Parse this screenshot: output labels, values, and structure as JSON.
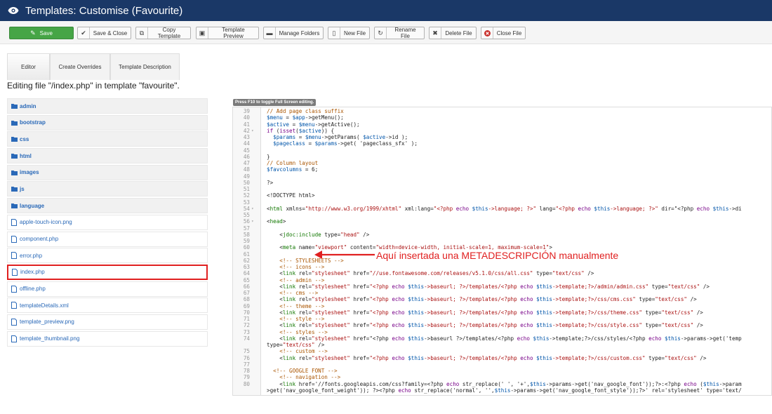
{
  "header": {
    "title": "Templates: Customise (Favourite)",
    "icon": "eye-icon"
  },
  "toolbar": {
    "save": "Save",
    "save_close": "Save & Close",
    "copy_template": "Copy Template",
    "template_preview": "Template Preview",
    "manage_folders": "Manage Folders",
    "new_file": "New File",
    "rename_file": "Rename File",
    "delete_file": "Delete File",
    "close_file": "Close File"
  },
  "tabs": [
    "Editor",
    "Create Overrides",
    "Template Description"
  ],
  "editing_text": "Editing file \"/index.php\" in template \"favourite\".",
  "tree": {
    "folders": [
      "admin",
      "bootstrap",
      "css",
      "html",
      "images",
      "js",
      "language"
    ],
    "files": [
      "apple-touch-icon.png",
      "component.php",
      "error.php",
      "index.php",
      "offline.php",
      "templateDetails.xml",
      "template_preview.png",
      "template_thumbnail.png"
    ],
    "selected": "index.php"
  },
  "editor": {
    "hint": "Press F10 to toggle Full Screen editing.",
    "lines": [
      [
        "39",
        "",
        "// Add page class suffix"
      ],
      [
        "40",
        "",
        "$menu = $app->getMenu();"
      ],
      [
        "41",
        "",
        "$active = $menu->getActive();"
      ],
      [
        "42",
        "▾",
        "if (isset($active)) {"
      ],
      [
        "43",
        "",
        "  $params = $menu->getParams( $active->id );"
      ],
      [
        "44",
        "",
        "  $pageclass = $params->get( 'pageclass_sfx' );"
      ],
      [
        "45",
        "",
        ""
      ],
      [
        "46",
        "",
        "}"
      ],
      [
        "47",
        "",
        "// Column layout"
      ],
      [
        "48",
        "",
        "$favcolumns = 6;"
      ],
      [
        "49",
        "",
        ""
      ],
      [
        "50",
        "",
        "?>"
      ],
      [
        "51",
        "",
        ""
      ],
      [
        "52",
        "",
        "<!DOCTYPE html>"
      ],
      [
        "53",
        "",
        ""
      ],
      [
        "54",
        "▾",
        "<html xmlns=\"http://www.w3.org/1999/xhtml\" xml:lang=\"<?php echo $this->language; ?>\" lang=\"<?php echo $this->language; ?>\" dir=\"<?php echo $this->di"
      ],
      [
        "55",
        "",
        ""
      ],
      [
        "56",
        "▾",
        "<head>"
      ],
      [
        "57",
        "",
        ""
      ],
      [
        "58",
        "",
        "    <jdoc:include type=\"head\" />"
      ],
      [
        "59",
        "",
        ""
      ],
      [
        "60",
        "",
        "    <meta name=\"viewport\" content=\"width=device-width, initial-scale=1, maximum-scale=1\">"
      ],
      [
        "61",
        "",
        ""
      ],
      [
        "62",
        "",
        "    <!-- STYLESHEETS -->"
      ],
      [
        "63",
        "",
        "    <!-- icons -->"
      ],
      [
        "64",
        "",
        "    <link rel=\"stylesheet\" href=\"//use.fontawesome.com/releases/v5.1.0/css/all.css\" type=\"text/css\" />"
      ],
      [
        "65",
        "",
        "    <!-- admin -->"
      ],
      [
        "66",
        "",
        "    <link rel=\"stylesheet\" href=\"<?php echo $this->baseurl; ?>/templates/<?php echo $this->template;?>/admin/admin.css\" type=\"text/css\" />"
      ],
      [
        "67",
        "",
        "    <!-- cms -->"
      ],
      [
        "68",
        "",
        "    <link rel=\"stylesheet\" href=\"<?php echo $this->baseurl; ?>/templates/<?php echo $this->template;?>/css/cms.css\" type=\"text/css\" />"
      ],
      [
        "69",
        "",
        "    <!-- theme -->"
      ],
      [
        "70",
        "",
        "    <link rel=\"stylesheet\" href=\"<?php echo $this->baseurl; ?>/templates/<?php echo $this->template;?>/css/theme.css\" type=\"text/css\" />"
      ],
      [
        "71",
        "",
        "    <!-- style -->"
      ],
      [
        "72",
        "",
        "    <link rel=\"stylesheet\" href=\"<?php echo $this->baseurl; ?>/templates/<?php echo $this->template;?>/css/style.css\" type=\"text/css\" />"
      ],
      [
        "73",
        "",
        "    <!-- styles -->"
      ],
      [
        "74",
        "",
        "    <link rel=\"stylesheet\" href=\"<?php echo $this->baseurl ?>/templates/<?php echo $this->template;?>/css/styles/<?php echo $this->params->get('temp"
      ],
      [
        "",
        "",
        "type=\"text/css\" />"
      ],
      [
        "75",
        "",
        "    <!-- custom -->"
      ],
      [
        "76",
        "",
        "    <link rel=\"stylesheet\" href=\"<?php echo $this->baseurl; ?>/templates/<?php echo $this->template;?>/css/custom.css\" type=\"text/css\" />"
      ],
      [
        "77",
        "",
        ""
      ],
      [
        "78",
        "",
        "  <!-- GOOGLE FONT -->"
      ],
      [
        "79",
        "",
        "    <!-- navigation -->"
      ],
      [
        "80",
        "",
        "    <link href='//fonts.googleapis.com/css?family=<?php echo str_replace(' ', '+',$this->params->get('nav_google_font'));?>:<?php echo ($this->param"
      ],
      [
        "",
        "",
        ">get('nav_google_font_weight')); ?><?php echo str_replace('normal', '',$this->params->get('nav_google_font_style'));?>' rel='stylesheet' type='text/"
      ]
    ]
  },
  "annotation": "Aquí insertada una METADESCRIPCIÓN manualmente",
  "colors": {
    "header_bg": "#1a3867",
    "save_green": "#46a546",
    "highlight_red": "#e02020",
    "link_blue": "#2a69b8"
  }
}
